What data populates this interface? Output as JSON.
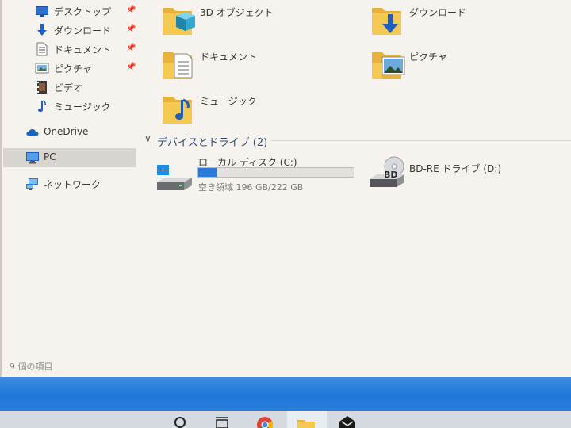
{
  "sidebar": {
    "items": [
      {
        "label": "デスクトップ",
        "icon": "desktop-icon",
        "pinned": true
      },
      {
        "label": "ダウンロード",
        "icon": "download-arrow-icon",
        "pinned": true
      },
      {
        "label": "ドキュメント",
        "icon": "document-icon",
        "pinned": true
      },
      {
        "label": "ピクチャ",
        "icon": "picture-icon",
        "pinned": true
      },
      {
        "label": "ビデオ",
        "icon": "video-icon",
        "pinned": false
      },
      {
        "label": "ミュージック",
        "icon": "music-note-icon",
        "pinned": false
      },
      {
        "label": "OneDrive",
        "icon": "cloud-icon",
        "pinned": false
      },
      {
        "label": "PC",
        "icon": "pc-monitor-icon",
        "pinned": false,
        "selected": true
      },
      {
        "label": "ネットワーク",
        "icon": "network-icon",
        "pinned": false
      }
    ],
    "pin_glyph": "📌"
  },
  "folders": [
    {
      "label": "3D オブジェクト",
      "icon": "3d-objects-folder-icon"
    },
    {
      "label": "ダウンロード",
      "icon": "downloads-folder-icon"
    },
    {
      "label": "ドキュメント",
      "icon": "documents-folder-icon"
    },
    {
      "label": "ピクチャ",
      "icon": "pictures-folder-icon"
    },
    {
      "label": "ミュージック",
      "icon": "music-folder-icon"
    }
  ],
  "devices_section": {
    "chevron": "∨",
    "title": "デバイスとドライブ (2)"
  },
  "drives": [
    {
      "label": "ローカル ディスク (C:)",
      "free_text": "空き領域 196 GB/222 GB",
      "used_fraction": 0.117,
      "icon": "windows-drive-icon"
    },
    {
      "label": "BD-RE ドライブ (D:)",
      "icon": "bd-drive-icon",
      "badge": "BD"
    }
  ],
  "status_bar": {
    "item_count": "9 個の項目"
  },
  "colors": {
    "accent": "#2a7bd5",
    "folder": "#f2c04a",
    "selection": "#d8d5d0",
    "section_title": "#2f4a7a"
  }
}
